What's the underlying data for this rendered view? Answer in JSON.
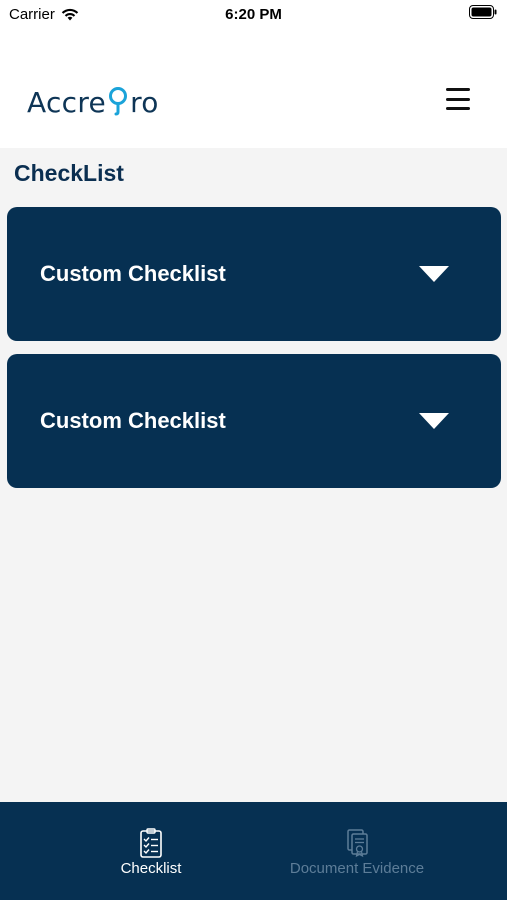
{
  "status_bar": {
    "carrier": "Carrier",
    "time": "6:20 PM"
  },
  "header": {
    "logo_left": "Accre",
    "logo_right": "ro",
    "brand_color": "#0e3556",
    "accent_color": "#1aa3d9"
  },
  "page": {
    "title": "CheckList"
  },
  "cards": [
    {
      "title": "Custom Checklist",
      "icon": "caret-down-icon"
    },
    {
      "title": "Custom Checklist",
      "icon": "caret-down-icon"
    }
  ],
  "tabbar": {
    "tabs": [
      {
        "label": "Checklist",
        "icon": "checklist-icon",
        "active": true
      },
      {
        "label": "Document Evidence",
        "icon": "document-evidence-icon",
        "active": false
      }
    ]
  },
  "colors": {
    "card_bg": "#063052",
    "page_bg": "#f4f4f4",
    "tab_inactive": "#5d7d98"
  }
}
